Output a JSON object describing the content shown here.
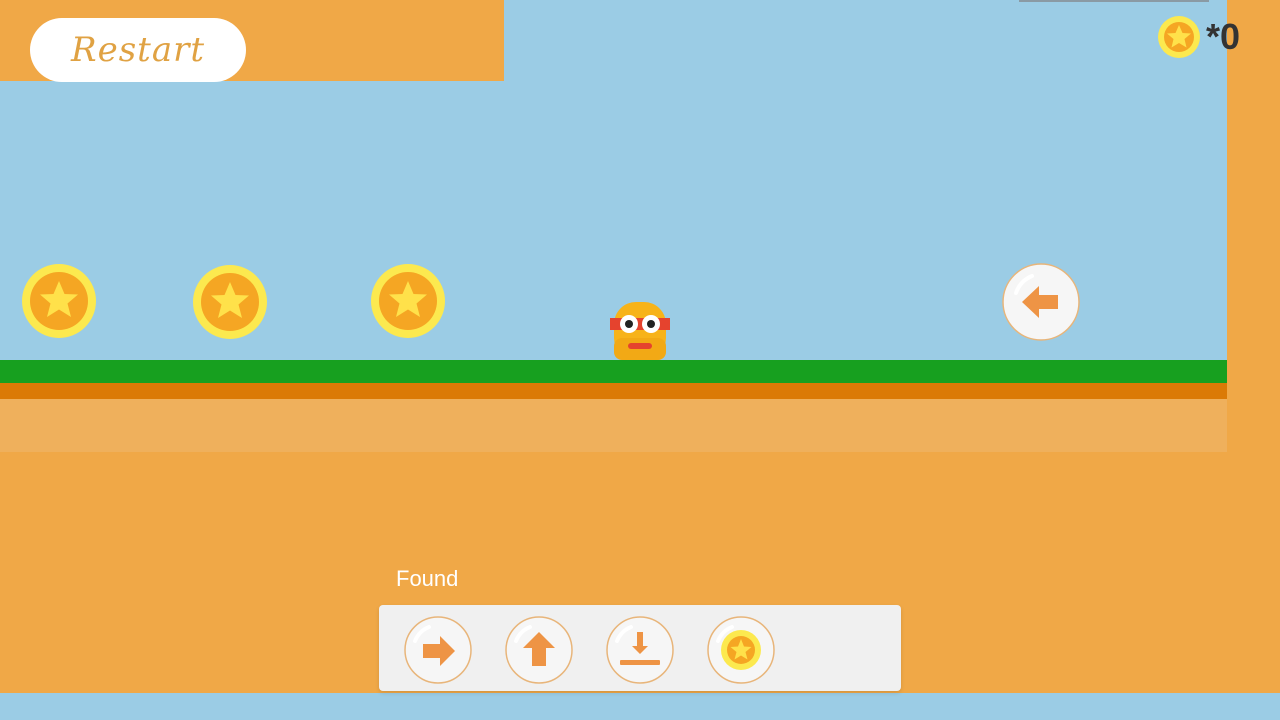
{
  "restart": {
    "label": "Restart"
  },
  "hud": {
    "coin_icon": "star-coin-icon",
    "coin_count": "*0"
  },
  "world": {
    "coins": [
      {
        "icon": "star-coin-icon"
      },
      {
        "icon": "star-coin-icon"
      },
      {
        "icon": "star-coin-icon"
      }
    ],
    "player": {
      "icon": "player-character"
    },
    "bubble": {
      "icon": "left-arrow-icon"
    }
  },
  "found": {
    "label": "Found",
    "items": [
      {
        "icon": "right-arrow-icon"
      },
      {
        "icon": "up-arrow-icon"
      },
      {
        "icon": "down-arrow-icon"
      },
      {
        "icon": "star-coin-icon"
      }
    ]
  },
  "colors": {
    "background": "#F0A847",
    "sky": "#9BCCE5",
    "grass": "#17A01F",
    "dirt": "#DB7A06",
    "sand": "#EFB05C",
    "coin_outer": "#FCE94F",
    "coin_inner": "#F5A623",
    "arrow": "#EE9445"
  }
}
